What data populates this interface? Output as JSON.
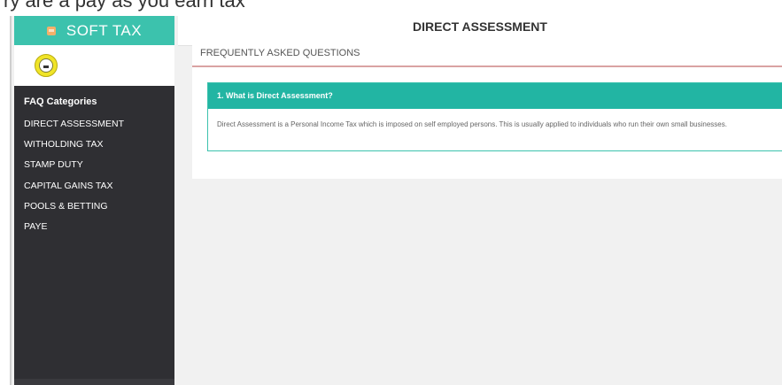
{
  "top_strip": {
    "cropped_text": "ry are a pay as you earn tax"
  },
  "sidebar": {
    "brand": "SOFT TAX",
    "categories_heading": "FAQ Categories",
    "categories": [
      "DIRECT ASSESSMENT",
      "WITHOLDING TAX",
      "STAMP DUTY",
      "CAPITAL GAINS TAX",
      "POOLS & BETTING",
      "PAYE"
    ]
  },
  "header": {
    "title": "DIRECT ASSESSMENT"
  },
  "panel": {
    "title": "FREQUENTLY ASKED QUESTIONS",
    "faqs": [
      {
        "question": "1. What is Direct Assessment?",
        "answer": "Direct Assessment is a Personal Income Tax which is imposed on self employed persons. This is usually applied to individuals who run their own small businesses."
      }
    ]
  },
  "colors": {
    "brand_teal": "#3cc2ad",
    "question_teal": "#22b5a3",
    "sidebar_dark": "#2f2f33",
    "panel_rule": "#d9a3a3"
  },
  "icons": {
    "brand": "calculator-icon",
    "logo": "emblem-logo"
  }
}
